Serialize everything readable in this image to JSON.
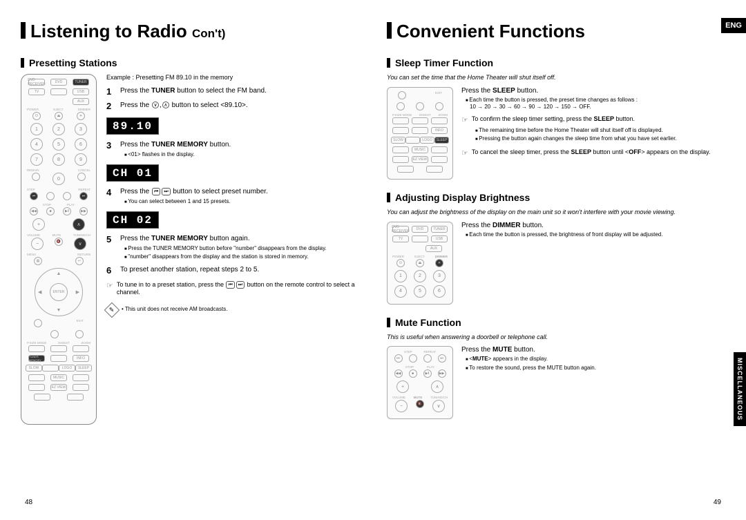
{
  "badges": {
    "lang": "ENG",
    "section": "MISCELLANEOUS"
  },
  "left_page": {
    "number": "48",
    "title_main": "Listening to Radio",
    "title_sub": "Con't)",
    "subtitle": "Presetting Stations",
    "example": "Example : Presetting FM 89.10 in the memory",
    "steps": {
      "s1": "Press the TUNER button to select the FM band.",
      "s2_a": "Press the ",
      "s2_b": " button to select <89.10>.",
      "disp1": "89.10",
      "s3": "Press the TUNER MEMORY button.",
      "s3_note": "<01> flashes in the display.",
      "disp2": "CH 01",
      "s4_a": "Press the ",
      "s4_b": " button to select preset number.",
      "s4_note": "You can select between 1 and 15 presets.",
      "disp3": "CH 02",
      "s5": "Press the TUNER  MEMORY button again.",
      "s5_note1": "Press the TUNER MEMORY button before \"number\" disappears from the display.",
      "s5_note2": "\"number\" disappears from the display and the station is stored in memory.",
      "s6": "To preset another station, repeat steps 2 to 5.",
      "hand_a": "To tune in to a preset station, press the ",
      "hand_b": " button on the remote control to select a channel.",
      "footnote": "This unit does not receive AM broadcasts."
    },
    "remote_labels": {
      "r1a": "DVD RECEIVER",
      "r1b": "DVD",
      "r1c": "TUNER",
      "r2a": "TV",
      "r2b": "",
      "r2c": "USB",
      "r2d": "AUX",
      "row_power": "POWER",
      "row_eject": "EJECT",
      "row_dimmer": "DIMMER",
      "d1": "1",
      "d2": "2",
      "d3": "3",
      "d4": "4",
      "d5": "5",
      "d6": "6",
      "d7": "7",
      "d8": "8",
      "d9": "9",
      "d0": "0",
      "remain": "REMAIN",
      "cancel": "CANCEL",
      "step": "STEP",
      "repeat": "REPEAT",
      "stop": "STOP",
      "play": "PLAY",
      "volume": "VOLUME",
      "mute": "MUTE",
      "tuning": "TUNING/CH",
      "menu": "MENU",
      "return": "RETURN",
      "enter": "ENTER",
      "exit": "EXIT",
      "grid1": "P.SIZE  MODE",
      "grid2": "DIGEST",
      "grid3": "ZOOM",
      "grid4": "",
      "grid5": "",
      "grid6": "INFO",
      "grid7": "SLOW",
      "grid8": "",
      "grid9": "LOGO",
      "grid10": "SLEEP",
      "grid11": "",
      "grid12": "MUSIC",
      "grid13": "",
      "grid14": "",
      "grid15": "EZ VIEW",
      "grid16": "",
      "grid17": "",
      "grid18": ""
    }
  },
  "right_page": {
    "number": "49",
    "title": "Convenient Functions",
    "sleep": {
      "heading": "Sleep Timer Function",
      "intro": "You can set the time that the Home Theater will shut itself off.",
      "line1": "Press the SLEEP button.",
      "note1": "Each time the button is pressed, the preset time changes as follows :",
      "note1b": "10 → 20 → 30 → 60 → 90 → 120 → 150 → OFF.",
      "hand1": "To confirm the sleep timer setting, press the SLEEP button.",
      "hand1_n1": "The remaining time before the Home Theater will shut itself off is displayed.",
      "hand1_n2": "Pressing the button again changes the sleep time from what you have set earlier.",
      "hand2": "To cancel the sleep timer, press the SLEEP button until <OFF> appears on the display."
    },
    "dimmer": {
      "heading": "Adjusting Display Brightness",
      "intro": "You can adjust the brightness of the display on the main unit so it won't interfere with your movie viewing.",
      "line1": "Press the DIMMER button.",
      "note1": "Each time the button is pressed, the brightness of front display will be adjusted."
    },
    "mute": {
      "heading": "Mute Function",
      "intro": "This is useful when answering a doorbell or telephone call.",
      "line1": "Press the MUTE button.",
      "note1": "<MUTE> appears in the display.",
      "note2": "To restore the sound, press the MUTE button again."
    }
  }
}
